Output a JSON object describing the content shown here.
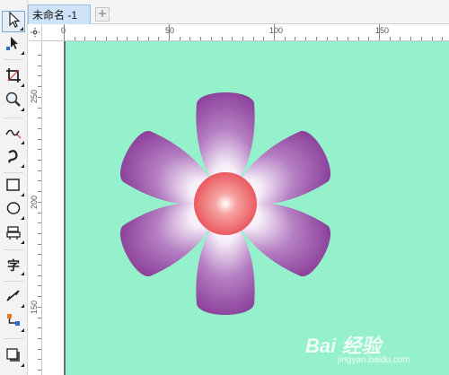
{
  "document": {
    "tab_title": "未命名 -1",
    "new_tab_icon": "plus-icon"
  },
  "toolbox": {
    "tools": [
      {
        "name": "pick-tool",
        "icon": "arrow-pointer-icon"
      },
      {
        "name": "shape-tool",
        "icon": "node-shape-icon"
      },
      {
        "name": "crop-tool",
        "icon": "crop-icon"
      },
      {
        "name": "zoom-tool",
        "icon": "magnifier-icon"
      },
      {
        "name": "freehand-tool",
        "icon": "freehand-curve-icon"
      },
      {
        "name": "artistic-media-tool",
        "icon": "brush-curve-icon"
      },
      {
        "name": "rectangle-tool",
        "icon": "rectangle-icon"
      },
      {
        "name": "ellipse-tool",
        "icon": "ellipse-icon"
      },
      {
        "name": "polygon-tool",
        "icon": "stamp-polygon-icon"
      },
      {
        "name": "text-tool",
        "icon": "text-icon",
        "glyph": "字"
      },
      {
        "name": "parallel-dimension-tool",
        "icon": "dimension-line-icon"
      },
      {
        "name": "connector-tool",
        "icon": "connector-icon"
      },
      {
        "name": "drop-shadow-tool",
        "icon": "drop-shadow-icon"
      }
    ]
  },
  "rulers": {
    "horizontal_labels": [
      "0",
      "50",
      "100",
      "150"
    ],
    "vertical_labels": [
      "250",
      "200",
      "150"
    ]
  },
  "canvas": {
    "background_color": "#95f1cc",
    "petal_color": "#8a3e98",
    "center_color": "#e84f54"
  },
  "watermark": {
    "brand": "Bai 经验",
    "url": "jingyan.baidu.com"
  }
}
